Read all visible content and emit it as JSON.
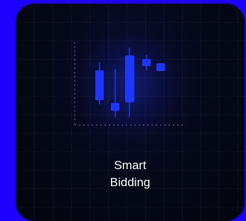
{
  "page": {
    "background_color": "#1e00ff"
  },
  "card": {
    "title_line1": "Smart",
    "title_line2": "Bidding",
    "icon": "candlestick-chart-icon",
    "accent_color": "#1f36ff"
  }
}
